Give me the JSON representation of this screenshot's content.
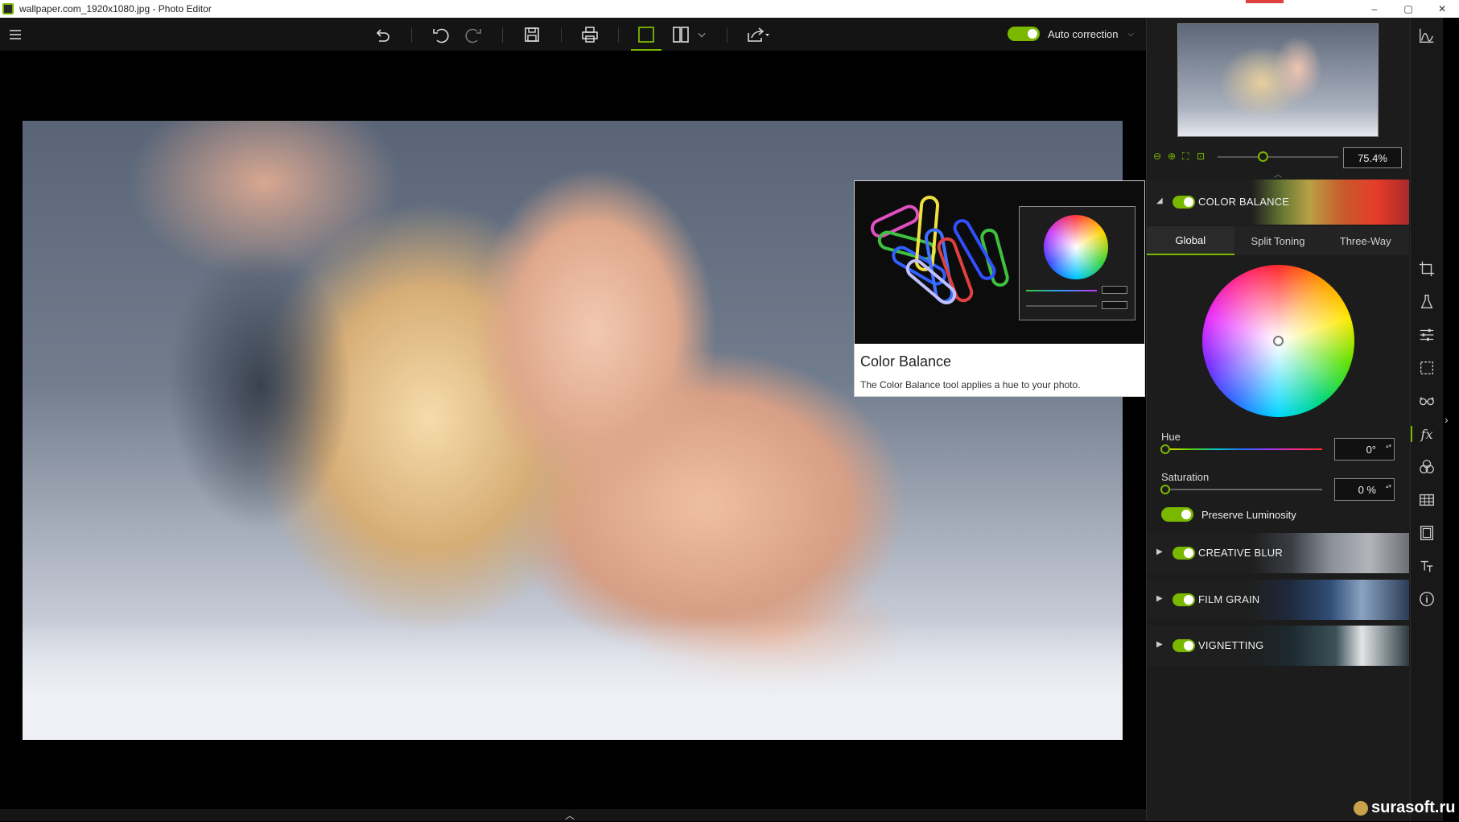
{
  "window": {
    "title": "wallpaper.com_1920x1080.jpg - Photo Editor",
    "controls": [
      "–",
      "▢",
      "✕"
    ]
  },
  "toolbar": {
    "menu_icon": "hamburger-icon",
    "buttons": [
      "undo-all-icon",
      "undo-icon",
      "redo-icon",
      "save-icon",
      "print-icon",
      "single-view-icon",
      "split-view-icon",
      "share-icon"
    ],
    "auto_correction_label": "Auto correction",
    "auto_correction_on": true
  },
  "tooltip": {
    "title": "Color Balance",
    "description": "The Color Balance tool applies a hue to your photo."
  },
  "navigator": {
    "zoom_value": "75.4%"
  },
  "color_balance": {
    "label": "COLOR BALANCE",
    "enabled": true,
    "tabs": [
      "Global",
      "Split Toning",
      "Three-Way"
    ],
    "active_tab": "Global",
    "hue_label": "Hue",
    "hue_value": "0°",
    "saturation_label": "Saturation",
    "saturation_value": "0 %",
    "preserve_luminosity_label": "Preserve Luminosity",
    "preserve_luminosity_on": true
  },
  "sections": [
    {
      "label": "CREATIVE BLUR",
      "enabled": true
    },
    {
      "label": "FILM GRAIN",
      "enabled": true
    },
    {
      "label": "VIGNETTING",
      "enabled": true
    }
  ],
  "rail_icons": [
    "histogram-icon",
    "crop-icon",
    "flask-icon",
    "adjust-sliders-icon",
    "selection-icon",
    "glasses-icon",
    "fx-icon",
    "color-mix-icon",
    "grid-icon",
    "frame-icon",
    "text-icon",
    "info-icon"
  ],
  "watermark": "surasoft.ru",
  "colors": {
    "accent": "#7ab800",
    "panel": "#1c1c1c",
    "toolbar": "#141414"
  }
}
